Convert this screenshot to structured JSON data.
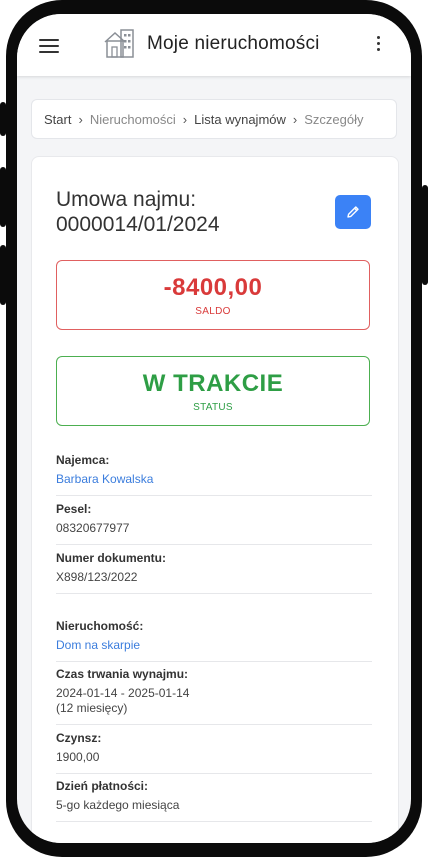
{
  "app": {
    "title": "Moje nieruchomości"
  },
  "breadcrumb": {
    "items": [
      "Start",
      "Nieruchomości",
      "Lista wynajmów",
      "Szczegóły"
    ]
  },
  "contract": {
    "title_line1": "Umowa najmu:",
    "title_line2": "0000014/01/2024"
  },
  "saldo": {
    "value": "-8400,00",
    "label": "SALDO"
  },
  "status": {
    "value": "W TRAKCIE",
    "label": "STATUS"
  },
  "fields": {
    "tenant": {
      "label": "Najemca:",
      "value": "Barbara Kowalska"
    },
    "pesel": {
      "label": "Pesel:",
      "value": "08320677977"
    },
    "doc": {
      "label": "Numer dokumentu:",
      "value": "X898/123/2022"
    },
    "property": {
      "label": "Nieruchomość:",
      "value": "Dom na skarpie"
    },
    "duration": {
      "label": "Czas trwania wynajmu:",
      "value": "2024-01-14 - 2025-01-14",
      "sub": "(12 miesięcy)"
    },
    "rent": {
      "label": "Czynsz:",
      "value": "1900,00"
    },
    "payday": {
      "label": "Dzień płatności:",
      "value": "5-go każdego miesiąca"
    }
  },
  "colors": {
    "accent": "#3b82f6",
    "danger": "#d93a3a",
    "success": "#2e9e45",
    "link": "#3b7ddd"
  },
  "icons": [
    "menu-icon",
    "house-logo-icon",
    "more-vert-icon",
    "chevron-right-icon",
    "pencil-icon"
  ]
}
